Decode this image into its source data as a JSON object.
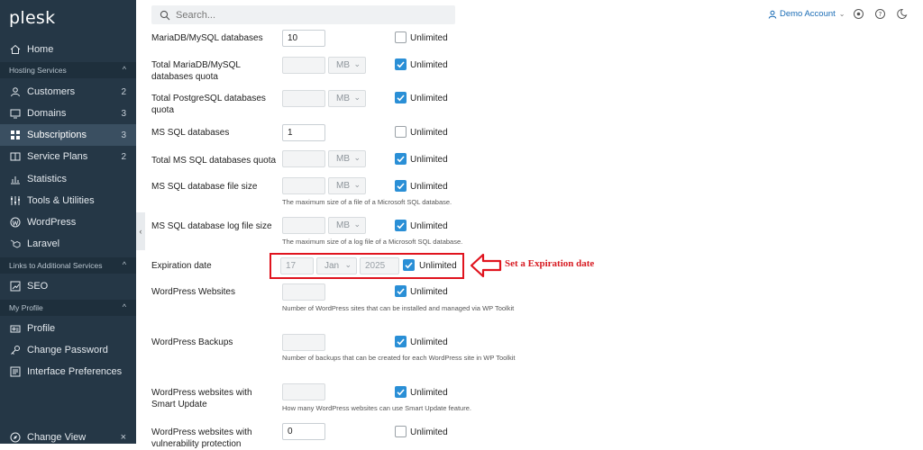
{
  "app": {
    "logo": "plesk"
  },
  "search": {
    "placeholder": "Search..."
  },
  "account": {
    "name": "Demo Account"
  },
  "sidebar": {
    "home": "Home",
    "hosting_section": "Hosting Services",
    "customers": {
      "label": "Customers",
      "count": "2"
    },
    "domains": {
      "label": "Domains",
      "count": "3"
    },
    "subscriptions": {
      "label": "Subscriptions",
      "count": "3"
    },
    "service_plans": {
      "label": "Service Plans",
      "count": "2"
    },
    "statistics": "Statistics",
    "tools": "Tools & Utilities",
    "wordpress": "WordPress",
    "laravel": "Laravel",
    "links_section": "Links to Additional Services",
    "seo": "SEO",
    "profile_section": "My Profile",
    "profile": "Profile",
    "change_password": "Change Password",
    "interface_prefs": "Interface Preferences",
    "change_view": "Change View"
  },
  "form": {
    "unlimited": "Unlimited",
    "mb": "MB",
    "mysql_dbs": {
      "label": "MariaDB/MySQL databases",
      "value": "10",
      "unlimited": false
    },
    "mysql_quota": {
      "label": "Total MariaDB/MySQL databases quota",
      "unlimited": true
    },
    "pg_quota": {
      "label": "Total PostgreSQL databases quota",
      "unlimited": true
    },
    "mssql_dbs": {
      "label": "MS SQL databases",
      "value": "1",
      "unlimited": false
    },
    "mssql_quota": {
      "label": "Total MS SQL databases quota",
      "unlimited": true
    },
    "mssql_file": {
      "label": "MS SQL database file size",
      "hint": "The maximum size of a file of a Microsoft SQL database.",
      "unlimited": true
    },
    "mssql_log": {
      "label": "MS SQL database log file size",
      "hint": "The maximum size of a log file of a Microsoft SQL database.",
      "unlimited": true
    },
    "expiration": {
      "label": "Expiration date",
      "day": "17",
      "month": "Jan",
      "year": "2025",
      "unlimited": true
    },
    "wp_sites": {
      "label": "WordPress Websites",
      "hint": "Number of WordPress sites that can be installed and managed via WP Toolkit",
      "unlimited": true
    },
    "wp_backups": {
      "label": "WordPress Backups",
      "hint": "Number of backups that can be created for each WordPress site in WP Toolkit",
      "unlimited": true
    },
    "wp_smart": {
      "label": "WordPress websites with Smart Update",
      "hint": "How many WordPress websites can use Smart Update feature.",
      "unlimited": true
    },
    "wp_vuln": {
      "label": "WordPress websites with vulnerability protection",
      "value": "0",
      "unlimited": false
    }
  },
  "annotation": {
    "text": "Set a Expiration date",
    "color": "#d71b22"
  },
  "colors": {
    "sidebar": "#253746",
    "accent": "#2a8fd6",
    "link": "#1a6cb5"
  }
}
